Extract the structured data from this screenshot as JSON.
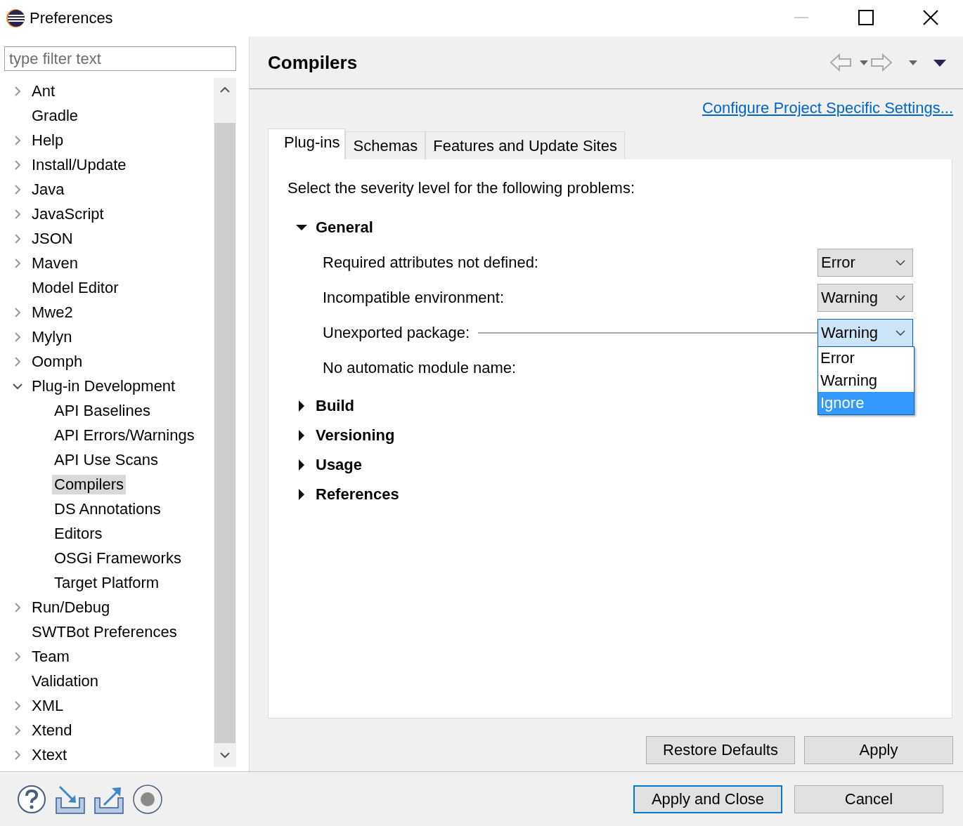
{
  "window": {
    "title": "Preferences"
  },
  "filter": {
    "placeholder": "type filter text"
  },
  "tree": [
    {
      "label": "Ant",
      "expanded": false,
      "selected": false
    },
    {
      "label": "Gradle",
      "selected": false
    },
    {
      "label": "Help",
      "expanded": false,
      "selected": false
    },
    {
      "label": "Install/Update",
      "expanded": false,
      "selected": false
    },
    {
      "label": "Java",
      "expanded": false,
      "selected": false
    },
    {
      "label": "JavaScript",
      "expanded": false,
      "selected": false
    },
    {
      "label": "JSON",
      "expanded": false,
      "selected": false
    },
    {
      "label": "Maven",
      "expanded": false,
      "selected": false
    },
    {
      "label": "Model Editor",
      "selected": false
    },
    {
      "label": "Mwe2",
      "expanded": false,
      "selected": false
    },
    {
      "label": "Mylyn",
      "expanded": false,
      "selected": false
    },
    {
      "label": "Oomph",
      "expanded": false,
      "selected": false
    },
    {
      "label": "Plug-in Development",
      "expanded": true,
      "selected": false,
      "children": [
        {
          "label": "API Baselines",
          "selected": false
        },
        {
          "label": "API Errors/Warnings",
          "selected": false
        },
        {
          "label": "API Use Scans",
          "selected": false
        },
        {
          "label": "Compilers",
          "selected": true
        },
        {
          "label": "DS Annotations",
          "selected": false
        },
        {
          "label": "Editors",
          "selected": false
        },
        {
          "label": "OSGi Frameworks",
          "selected": false
        },
        {
          "label": "Target Platform",
          "selected": false
        }
      ]
    },
    {
      "label": "Run/Debug",
      "expanded": false,
      "selected": false
    },
    {
      "label": "SWTBot Preferences",
      "selected": false
    },
    {
      "label": "Team",
      "expanded": false,
      "selected": false
    },
    {
      "label": "Validation",
      "selected": false
    },
    {
      "label": "XML",
      "expanded": false,
      "selected": false
    },
    {
      "label": "Xtend",
      "expanded": false,
      "selected": false
    },
    {
      "label": "Xtext",
      "expanded": false,
      "selected": false
    }
  ],
  "page": {
    "title": "Compilers",
    "link": "Configure Project Specific Settings...",
    "tabs": [
      {
        "label": "Plug-ins",
        "selected": true
      },
      {
        "label": "Schemas",
        "selected": false
      },
      {
        "label": "Features and Update Sites",
        "selected": false
      }
    ],
    "intro": "Select the severity level for the following problems:",
    "sections": [
      {
        "title": "General",
        "expanded": true,
        "rows": [
          {
            "label": "Required attributes not defined:",
            "value": "Error",
            "focused": false
          },
          {
            "label": "Incompatible environment:",
            "value": "Warning",
            "focused": false
          },
          {
            "label": "Unexported package:",
            "value": "Warning",
            "focused": true,
            "pointer": true,
            "menu": [
              {
                "label": "Error",
                "highlighted": false
              },
              {
                "label": "Warning",
                "highlighted": false
              },
              {
                "label": "Ignore",
                "highlighted": true
              }
            ]
          },
          {
            "label": "No automatic module name:"
          }
        ]
      },
      {
        "title": "Build",
        "expanded": false
      },
      {
        "title": "Versioning",
        "expanded": false
      },
      {
        "title": "Usage",
        "expanded": false
      },
      {
        "title": "References",
        "expanded": false
      }
    ],
    "buttons": [
      "Restore Defaults",
      "Apply"
    ]
  },
  "footer": {
    "buttons": [
      {
        "label": "Apply and Close",
        "default": true
      },
      {
        "label": "Cancel",
        "default": false
      }
    ]
  }
}
